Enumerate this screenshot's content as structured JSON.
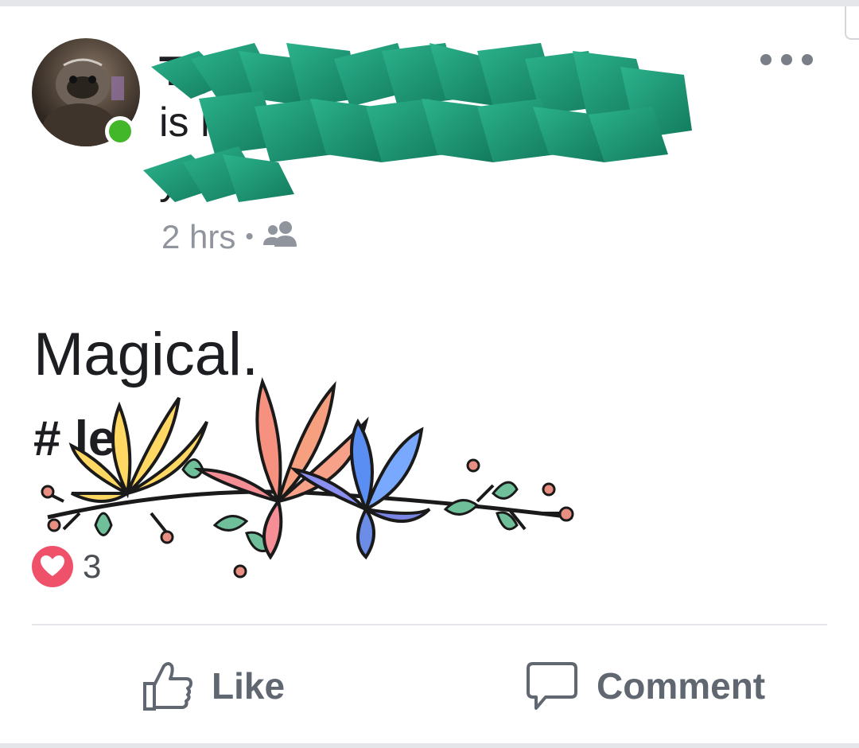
{
  "post": {
    "author_line1": "T                 y V      s",
    "author_line2": "is                                        n",
    "author_line3": "         y.",
    "time": "2 hrs",
    "separator": "•",
    "audience_icon": "friends-icon",
    "text": "Magical.",
    "hashtag": "#            le"
  },
  "reactions": {
    "icon": "heart-icon",
    "count": "3"
  },
  "actions": {
    "like_label": "Like",
    "comment_label": "Comment"
  },
  "colors": {
    "online": "#42b72a",
    "heart": "#f0516a",
    "scribble": "#1e9e7a",
    "text": "#1c1e21",
    "meta": "#90949c"
  }
}
